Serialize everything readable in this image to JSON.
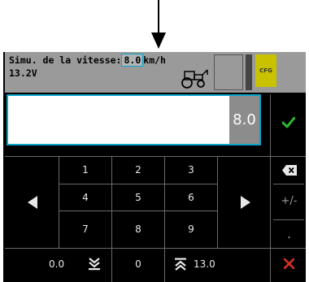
{
  "header": {
    "label": "Simu. de la vitesse:",
    "speed_value": " 8.0",
    "unit": "km/h",
    "voltage": "13.2V",
    "cfg_label": "CFG"
  },
  "input": {
    "value": "8.0"
  },
  "keypad": {
    "row1": [
      "1",
      "2",
      "3"
    ],
    "row2": [
      "4",
      "5",
      "6"
    ],
    "row3": [
      "7",
      "8",
      "9"
    ],
    "zero": "0",
    "plus_minus": "+/-",
    "decimal": "."
  },
  "range": {
    "min": "0.0",
    "max": "13.0"
  },
  "colors": {
    "accent": "#0aa3c9",
    "confirm": "#2eb82e",
    "cancel": "#e0302a",
    "cfg": "#c9c200"
  },
  "icons": {
    "pointer": "down-arrow-icon",
    "tractor": "tractor-icon",
    "confirm": "checkmark-icon",
    "backspace": "backspace-icon",
    "left": "left-arrow-icon",
    "right": "right-arrow-icon",
    "min": "double-down-chevron-icon",
    "max": "double-up-chevron-icon",
    "cancel": "cancel-x-icon"
  }
}
